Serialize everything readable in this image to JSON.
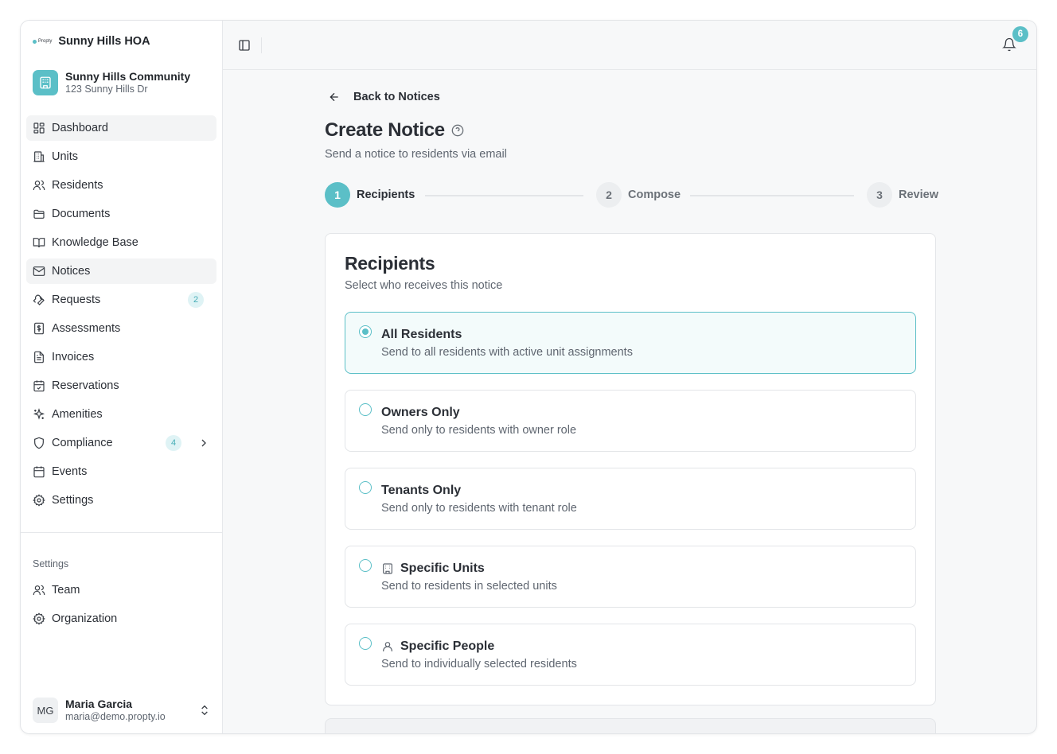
{
  "brand": {
    "logo_text": "Propty",
    "org_name": "Sunny Hills HOA"
  },
  "community": {
    "name": "Sunny Hills Community",
    "address": "123 Sunny Hills Dr"
  },
  "sidebar": {
    "items": [
      {
        "label": "Dashboard",
        "icon": "dashboard-icon"
      },
      {
        "label": "Units",
        "icon": "building-icon"
      },
      {
        "label": "Residents",
        "icon": "users-icon"
      },
      {
        "label": "Documents",
        "icon": "folder-icon"
      },
      {
        "label": "Knowledge Base",
        "icon": "book-icon"
      },
      {
        "label": "Notices",
        "icon": "mail-icon"
      },
      {
        "label": "Requests",
        "icon": "wrench-icon",
        "badge": "2"
      },
      {
        "label": "Assessments",
        "icon": "dollar-icon"
      },
      {
        "label": "Invoices",
        "icon": "file-icon"
      },
      {
        "label": "Reservations",
        "icon": "calendar-check-icon"
      },
      {
        "label": "Amenities",
        "icon": "sparkles-icon"
      },
      {
        "label": "Compliance",
        "icon": "shield-icon",
        "badge": "4"
      },
      {
        "label": "Events",
        "icon": "calendar-icon"
      },
      {
        "label": "Settings",
        "icon": "gear-icon"
      }
    ],
    "settings_section": {
      "label": "Settings",
      "items": [
        {
          "label": "Team",
          "icon": "users-icon"
        },
        {
          "label": "Organization",
          "icon": "gear-icon"
        }
      ]
    }
  },
  "user": {
    "initials": "MG",
    "name": "Maria Garcia",
    "email": "maria@demo.propty.io"
  },
  "topbar": {
    "notification_count": "6"
  },
  "page": {
    "back_label": "Back to Notices",
    "title": "Create Notice",
    "subtitle": "Send a notice to residents via email"
  },
  "stepper": {
    "steps": [
      {
        "number": "1",
        "label": "Recipients",
        "state": "active"
      },
      {
        "number": "2",
        "label": "Compose",
        "state": "inactive"
      },
      {
        "number": "3",
        "label": "Review",
        "state": "inactive"
      }
    ]
  },
  "recipients": {
    "title": "Recipients",
    "subtitle": "Select who receives this notice",
    "selected": "All Residents",
    "options": [
      {
        "title": "All Residents",
        "description": "Send to all residents with active unit assignments"
      },
      {
        "title": "Owners Only",
        "description": "Send only to residents with owner role"
      },
      {
        "title": "Tenants Only",
        "description": "Send only to residents with tenant role"
      },
      {
        "title": "Specific Units",
        "description": "Send to residents in selected units",
        "icon": "building-icon"
      },
      {
        "title": "Specific People",
        "description": "Send to individually selected residents",
        "icon": "user-icon"
      }
    ]
  },
  "colors": {
    "accent": "#5bbfc7",
    "accent_light": "#f3fbfb",
    "badge_bg": "#dff3f5"
  }
}
